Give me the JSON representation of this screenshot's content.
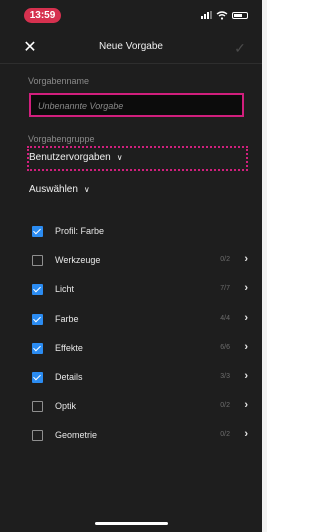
{
  "status_bar": {
    "time": "13:59"
  },
  "header": {
    "title": "Neue Vorgabe",
    "close": "✕",
    "confirm": "✓"
  },
  "preset_name": {
    "label": "Vorgabenname",
    "placeholder": "Unbenannte Vorgabe"
  },
  "preset_group": {
    "label": "Vorgabengruppe",
    "value": "Benutzervorgaben"
  },
  "select_menu": {
    "label": "Auswählen"
  },
  "settings": [
    {
      "label": "Profil: Farbe",
      "checked": true,
      "count": "",
      "expandable": false
    },
    {
      "label": "Werkzeuge",
      "checked": false,
      "count": "0/2",
      "expandable": true
    },
    {
      "label": "Licht",
      "checked": true,
      "count": "7/7",
      "expandable": true
    },
    {
      "label": "Farbe",
      "checked": true,
      "count": "4/4",
      "expandable": true
    },
    {
      "label": "Effekte",
      "checked": true,
      "count": "6/6",
      "expandable": true
    },
    {
      "label": "Details",
      "checked": true,
      "count": "3/3",
      "expandable": true
    },
    {
      "label": "Optik",
      "checked": false,
      "count": "0/2",
      "expandable": true
    },
    {
      "label": "Geometrie",
      "checked": false,
      "count": "0/2",
      "expandable": true
    }
  ],
  "colors": {
    "accent": "#2b8cf2",
    "highlight": "#d11f7d",
    "background": "#1e1e1e",
    "time_pill": "#d6314f"
  }
}
